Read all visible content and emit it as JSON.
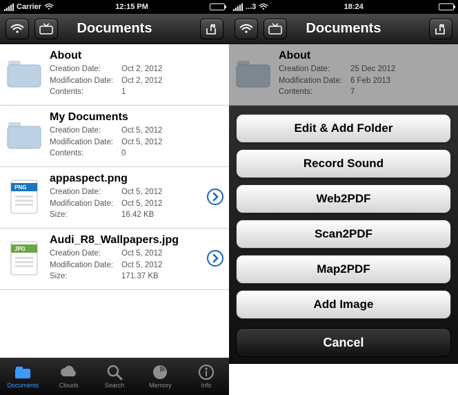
{
  "left": {
    "statusbar": {
      "carrier": "Carrier",
      "time": "12:15 PM"
    },
    "navbar": {
      "title": "Documents"
    },
    "items": [
      {
        "kind": "folder",
        "title": "About",
        "creationLabel": "Creation Date:",
        "creation": "Oct 2, 2012",
        "modLabel": "Modification Date:",
        "mod": "Oct 2, 2012",
        "sizeLabel": "Contents:",
        "size": "1"
      },
      {
        "kind": "folder",
        "title": "My Documents",
        "creationLabel": "Creation Date:",
        "creation": "Oct 5, 2012",
        "modLabel": "Modification Date:",
        "mod": "Oct 5, 2012",
        "sizeLabel": "Contents:",
        "size": "0"
      },
      {
        "kind": "file",
        "band": "#1C75BC",
        "ext": "PNG",
        "title": "appaspect.png",
        "creationLabel": "Creation Date:",
        "creation": "Oct 5, 2012",
        "modLabel": "Modification Date:",
        "mod": "Oct 5, 2012",
        "sizeLabel": "Size:",
        "size": "16.42 KB"
      },
      {
        "kind": "file",
        "band": "#6CA544",
        "ext": "JPG",
        "title": "Audi_R8_Wallpapers.jpg",
        "creationLabel": "Creation Date:",
        "creation": "Oct 5, 2012",
        "modLabel": "Modification Date:",
        "mod": "Oct 5, 2012",
        "sizeLabel": "Size:",
        "size": "171.37 KB"
      }
    ],
    "tabs": [
      {
        "label": "Documents",
        "active": true
      },
      {
        "label": "Clouds",
        "active": false
      },
      {
        "label": "Search",
        "active": false
      },
      {
        "label": "Memory",
        "active": false
      },
      {
        "label": "Info",
        "active": false
      }
    ]
  },
  "right": {
    "statusbar": {
      "carrier": "...3",
      "time": "18:24"
    },
    "navbar": {
      "title": "Documents"
    },
    "peekItem": {
      "title": "About",
      "creationLabel": "Creation Date:",
      "creation": "25 Dec 2012",
      "modLabel": "Modification Date:",
      "mod": "6 Feb 2013",
      "sizeLabel": "Contents:",
      "size": "7"
    },
    "sheet": {
      "actions": [
        "Edit & Add Folder",
        "Record Sound",
        "Web2PDF",
        "Scan2PDF",
        "Map2PDF",
        "Add Image"
      ],
      "cancel": "Cancel"
    }
  }
}
